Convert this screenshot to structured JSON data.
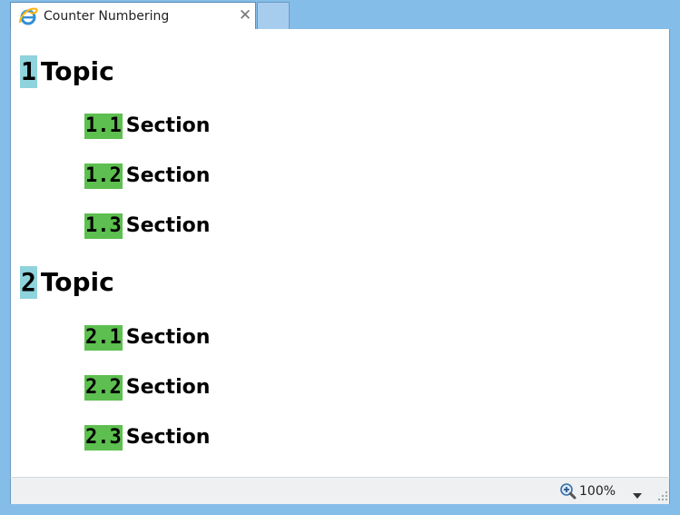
{
  "tab": {
    "title": "Counter Numbering",
    "close_glyph": "✕",
    "icon": "internet-explorer-icon"
  },
  "document": {
    "topics": [
      {
        "number": "1",
        "label": "Topic",
        "sections": [
          {
            "number": "1.1",
            "label": "Section"
          },
          {
            "number": "1.2",
            "label": "Section"
          },
          {
            "number": "1.3",
            "label": "Section"
          }
        ]
      },
      {
        "number": "2",
        "label": "Topic",
        "sections": [
          {
            "number": "2.1",
            "label": "Section"
          },
          {
            "number": "2.2",
            "label": "Section"
          },
          {
            "number": "2.3",
            "label": "Section"
          }
        ]
      }
    ]
  },
  "status_bar": {
    "zoom_level": "100%",
    "zoom_icon": "zoom-in-icon"
  },
  "colors": {
    "topic_counter_bg": "#8fd3dc",
    "section_counter_bg": "#5dbf4f",
    "frame": "#84bde8"
  }
}
